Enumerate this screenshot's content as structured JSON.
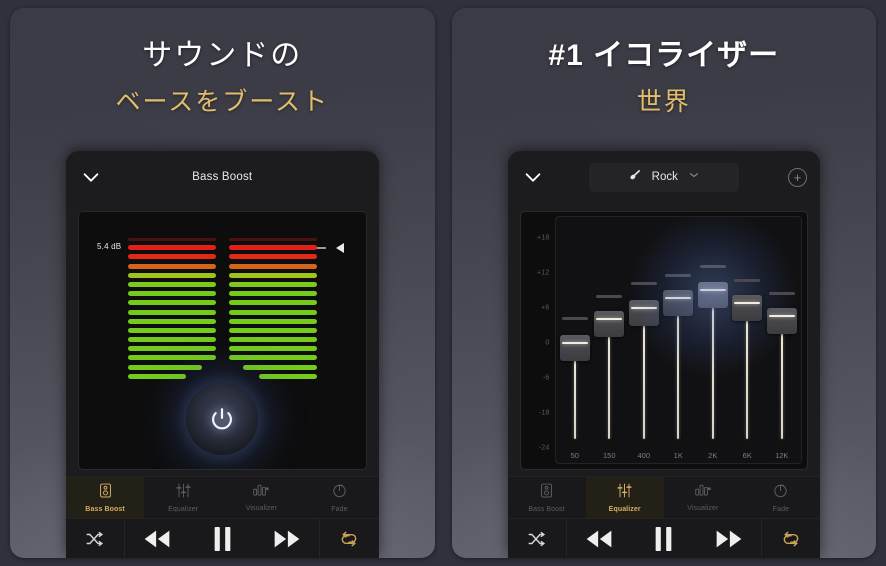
{
  "panels": [
    {
      "id": "bass-boost",
      "headline": "サウンドの",
      "subline": "ベースをブースト",
      "header": {
        "title": "Bass Boost",
        "chevron_icon": "chevron-down-icon"
      },
      "mode": "vu",
      "vu": {
        "db_value": "5.4 dB",
        "left_tick_icon": "dash-marker",
        "right_tick_icon": "dash-marker",
        "pointer_icon": "triangle-left-icon",
        "power_icon": "power-icon",
        "segment_colors": [
          "#7d1614",
          "#e21f19",
          "#e02a16",
          "#d4661c",
          "#9fc41b",
          "#7ec91c",
          "#74cb1b",
          "#74cb1b",
          "#74cb1b",
          "#74cb1b",
          "#74cb1b",
          "#74cb1b",
          "#74cb1b",
          "#74cb1b",
          "#74cb1b",
          "#74cb1b"
        ],
        "segments_total": 16
      },
      "tabs": [
        {
          "label": "Bass Boost",
          "icon": "speaker-icon",
          "active": true
        },
        {
          "label": "Equalizer",
          "icon": "sliders-icon",
          "active": false
        },
        {
          "label": "Visualizer",
          "icon": "bars-icon",
          "active": false
        },
        {
          "label": "Fade",
          "icon": "fade-circle-icon",
          "active": false
        }
      ],
      "transport": [
        {
          "name": "shuffle-button",
          "icon": "shuffle-icon",
          "gold": false
        },
        {
          "name": "previous-button",
          "icon": "rewind-icon",
          "gold": false
        },
        {
          "name": "play-pause-button",
          "icon": "pause-icon",
          "gold": false
        },
        {
          "name": "next-button",
          "icon": "fast-forward-icon",
          "gold": false
        },
        {
          "name": "repeat-button",
          "icon": "repeat-one-icon",
          "gold": true
        }
      ]
    },
    {
      "id": "equalizer",
      "headline_prefix": "#1",
      "headline": "#1 イコライザー",
      "subline": "世界",
      "header": {
        "title": "Rock",
        "chevron_icon": "chevron-down-icon",
        "preset_icon": "guitar-icon",
        "dropdown_icon": "chevron-down-small-icon",
        "add_icon": "plus-circle-icon",
        "add_label": "+"
      },
      "mode": "eq",
      "eq": {
        "y_labels": [
          "+18",
          "+12",
          "+6",
          "0",
          "-6",
          "-18",
          "-24"
        ],
        "y_min": -24,
        "y_max": 18,
        "bands": [
          {
            "freq": "50",
            "value": -4.0,
            "ghost": -0.5,
            "hot": false
          },
          {
            "freq": "150",
            "value": 0.5,
            "ghost": 3.5,
            "hot": false
          },
          {
            "freq": "400",
            "value": 2.5,
            "ghost": 6.0,
            "hot": false
          },
          {
            "freq": "1K",
            "value": 4.5,
            "ghost": 7.5,
            "hot": false
          },
          {
            "freq": "2K",
            "value": 6.0,
            "ghost": 9.0,
            "hot": true
          },
          {
            "freq": "6K",
            "value": 3.5,
            "ghost": 6.5,
            "hot": false
          },
          {
            "freq": "12K",
            "value": 1.0,
            "ghost": 4.0,
            "hot": false
          }
        ]
      },
      "tabs": [
        {
          "label": "Bass Boost",
          "icon": "speaker-icon",
          "active": false
        },
        {
          "label": "Equalizer",
          "icon": "sliders-icon",
          "active": true
        },
        {
          "label": "Visualizer",
          "icon": "bars-icon",
          "active": false
        },
        {
          "label": "Fade",
          "icon": "fade-circle-icon",
          "active": false
        }
      ],
      "transport": [
        {
          "name": "shuffle-button",
          "icon": "shuffle-icon",
          "gold": false
        },
        {
          "name": "previous-button",
          "icon": "rewind-icon",
          "gold": false
        },
        {
          "name": "play-pause-button",
          "icon": "pause-icon",
          "gold": false
        },
        {
          "name": "next-button",
          "icon": "fast-forward-icon",
          "gold": false
        },
        {
          "name": "repeat-button",
          "icon": "repeat-one-icon",
          "gold": true
        }
      ]
    }
  ],
  "colors": {
    "accent_gold": "#d4ae63",
    "subline_gold": "#e3bd6a",
    "panel_bg_top": "#3b3b45",
    "panel_bg_bottom": "#5d5d69",
    "app_bg": "#1c1c1e",
    "screen_bg": "#0d0d0e"
  }
}
